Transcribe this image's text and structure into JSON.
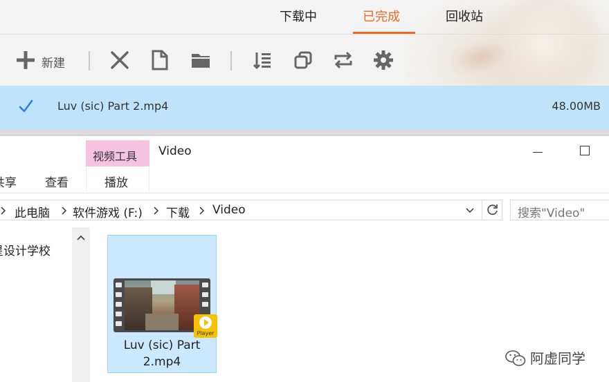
{
  "download_manager": {
    "tabs": [
      "下载中",
      "已完成",
      "回收站"
    ],
    "active_tab": "已完成",
    "accent": "#ef6a1f",
    "toolbar": {
      "new_label": "新建",
      "icons": [
        "plus-icon",
        "close-icon",
        "file-icon",
        "folder-icon",
        "list-icon",
        "copy-icon",
        "repeat-icon",
        "gear-icon"
      ]
    },
    "row": {
      "check": "✓",
      "name": "Luv (sic) Part 2.mp4",
      "size": "48.00MB",
      "highlight": "#bfe3fb"
    }
  },
  "explorer": {
    "contextual_tab": "视频工具",
    "contextual_color": "#f5c3df",
    "window_title": "Video",
    "ribbon_tabs": [
      "共享",
      "查看",
      "播放"
    ],
    "breadcrumb": [
      "此电脑",
      "软件游戏 (F:)",
      "下载",
      "Video"
    ],
    "search_placeholder": "搜索\"Video\"",
    "nav_item": "星设计学校",
    "file": {
      "name_line1": "Luv (sic) Part",
      "name_line2": "2.mp4",
      "badge_text": "Player"
    }
  },
  "watermark": "阿虚同学"
}
